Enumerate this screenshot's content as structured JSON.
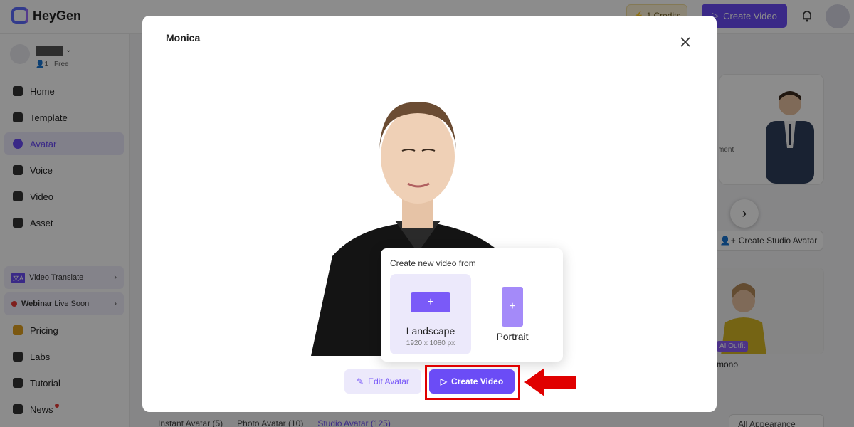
{
  "app": {
    "logo_text": "HeyGen"
  },
  "topbar": {
    "credits": "1 Credits",
    "create_video": "Create Video"
  },
  "workspace": {
    "members": "1",
    "plan": "Free"
  },
  "sidebar": {
    "items": [
      {
        "label": "Home"
      },
      {
        "label": "Template"
      },
      {
        "label": "Avatar"
      },
      {
        "label": "Voice"
      },
      {
        "label": "Video"
      },
      {
        "label": "Asset"
      }
    ],
    "promo_translate": "Video Translate",
    "promo_webinar_bold": "Webinar",
    "promo_webinar_rest": " Live Soon",
    "bottom": [
      {
        "label": "Pricing"
      },
      {
        "label": "Labs"
      },
      {
        "label": "Tutorial"
      },
      {
        "label": "News"
      }
    ]
  },
  "background": {
    "studio_button": "Create Studio Avatar",
    "card_partial": "ment",
    "ai_outfit": "AI Outfit",
    "card_name": "mono",
    "tabs": [
      "Instant Avatar (5)",
      "Photo Avatar (10)",
      "Studio Avatar (125)"
    ],
    "appearance": "All Appearance"
  },
  "modal": {
    "title": "Monica",
    "popover_title": "Create new video from",
    "landscape_label": "Landscape",
    "landscape_size": "1920 x 1080 px",
    "portrait_label": "Portrait",
    "edit_avatar": "Edit Avatar",
    "create_video": "Create Video"
  },
  "colors": {
    "accent": "#6b4cf6",
    "highlight": "#e00000",
    "overlay": "rgba(0,0,0,0.45)"
  }
}
